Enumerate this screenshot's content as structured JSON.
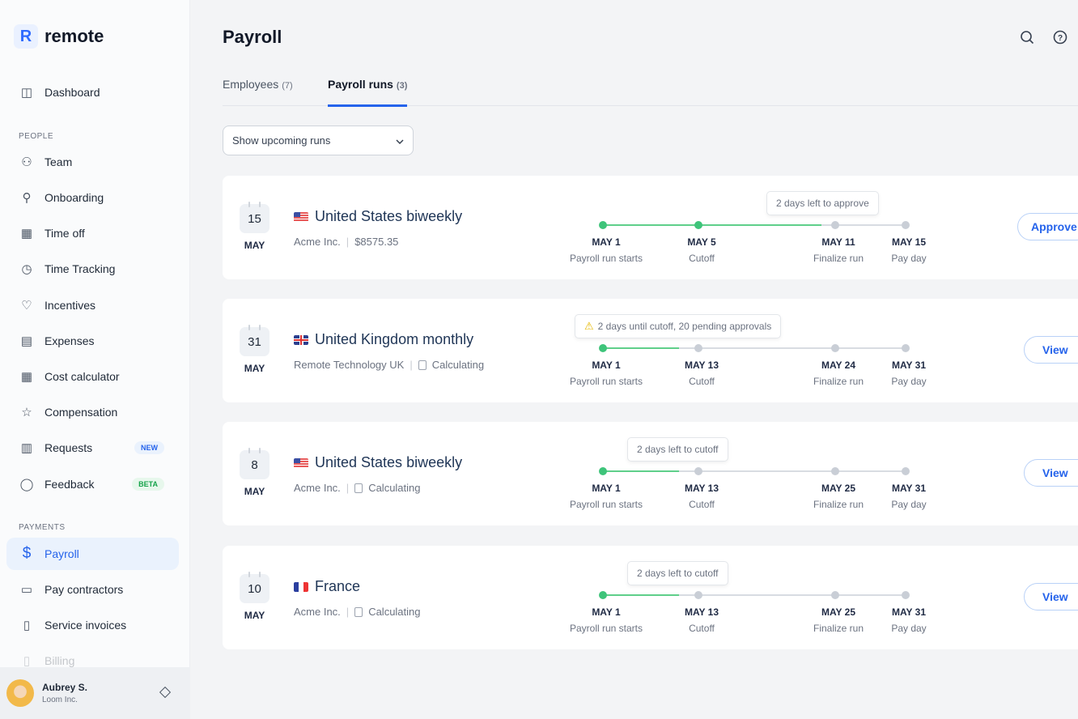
{
  "app": {
    "logo_text": "remote",
    "logo_mark": "R"
  },
  "sidebar": {
    "items": [
      {
        "label": "Dashboard",
        "icon": "sidebar-panel-icon",
        "glyph": "◫"
      },
      {
        "label": "Team",
        "icon": "team-icon",
        "glyph": "⚇"
      },
      {
        "label": "Onboarding",
        "icon": "user-plus-icon",
        "glyph": "⚲"
      },
      {
        "label": "Time off",
        "icon": "calendar-icon",
        "glyph": "▦"
      },
      {
        "label": "Time Tracking",
        "icon": "clock-icon",
        "glyph": "◷"
      },
      {
        "label": "Incentives",
        "icon": "heart-icon",
        "glyph": "♡"
      },
      {
        "label": "Expenses",
        "icon": "receipt-icon",
        "glyph": "▤"
      },
      {
        "label": "Cost calculator",
        "icon": "calculator-icon",
        "glyph": "▦"
      },
      {
        "label": "Compensation",
        "icon": "star-icon",
        "glyph": "☆"
      },
      {
        "label": "Requests",
        "icon": "request-icon",
        "glyph": "▥",
        "badge": "NEW"
      },
      {
        "label": "Feedback",
        "icon": "chat-bubble-icon",
        "glyph": "◯",
        "badge": "BETA"
      },
      {
        "label": "Payroll",
        "icon": "dollar-icon",
        "glyph": "$"
      },
      {
        "label": "Pay contractors",
        "icon": "card-icon",
        "glyph": "▭"
      },
      {
        "label": "Service invoices",
        "icon": "invoice-icon",
        "glyph": "▯"
      },
      {
        "label": "Billing",
        "icon": "billing-icon",
        "glyph": "▯"
      }
    ],
    "sections": {
      "people": "PEOPLE",
      "payments": "PAYMENTS"
    },
    "user": {
      "name": "Aubrey S.",
      "company": "Loom Inc."
    }
  },
  "header": {
    "title": "Payroll"
  },
  "tabs": [
    {
      "label": "Employees",
      "count": "(7)"
    },
    {
      "label": "Payroll runs",
      "count": "(3)"
    }
  ],
  "filter": {
    "value": "Show upcoming runs"
  },
  "colors": {
    "accent": "#2563eb",
    "progress": "#3ec47a"
  },
  "runs": [
    {
      "day": "15",
      "month": "MAY",
      "flag": "us",
      "name": "United States biweekly",
      "entity": "Acme Inc.",
      "detail": "$8575.35",
      "tooltip": "2 days left to approve",
      "warning": false,
      "completed_steps": 2,
      "progress_to_next": 0.9,
      "action": "Approve",
      "milestones": [
        {
          "date": "MAY 1",
          "label": "Payroll run starts"
        },
        {
          "date": "MAY 5",
          "label": "Cutoff"
        },
        {
          "date": "MAY 11",
          "label": "Finalize run"
        },
        {
          "date": "MAY 15",
          "label": "Pay day"
        }
      ]
    },
    {
      "day": "31",
      "month": "MAY",
      "flag": "uk",
      "name": "United Kingdom monthly",
      "entity": "Remote Technology UK",
      "detail": "Calculating",
      "tooltip": "2 days until cutoff, 20 pending approvals",
      "warning": true,
      "completed_steps": 1,
      "progress_to_next": 0.8,
      "action": "View",
      "milestones": [
        {
          "date": "MAY 1",
          "label": "Payroll run starts"
        },
        {
          "date": "MAY 13",
          "label": "Cutoff"
        },
        {
          "date": "MAY 24",
          "label": "Finalize run"
        },
        {
          "date": "MAY 31",
          "label": "Pay day"
        }
      ]
    },
    {
      "day": "8",
      "month": "MAY",
      "flag": "us",
      "name": "United States biweekly",
      "entity": "Acme Inc.",
      "detail": "Calculating",
      "tooltip": "2 days left to cutoff",
      "warning": false,
      "completed_steps": 1,
      "progress_to_next": 0.8,
      "action": "View",
      "milestones": [
        {
          "date": "MAY 1",
          "label": "Payroll run starts"
        },
        {
          "date": "MAY 13",
          "label": "Cutoff"
        },
        {
          "date": "MAY 25",
          "label": "Finalize run"
        },
        {
          "date": "MAY 31",
          "label": "Pay day"
        }
      ]
    },
    {
      "day": "10",
      "month": "MAY",
      "flag": "fr",
      "name": "France",
      "entity": "Acme Inc.",
      "detail": "Calculating",
      "tooltip": "2 days left to cutoff",
      "warning": false,
      "completed_steps": 1,
      "progress_to_next": 0.8,
      "action": "View",
      "milestones": [
        {
          "date": "MAY 1",
          "label": "Payroll run starts"
        },
        {
          "date": "MAY 13",
          "label": "Cutoff"
        },
        {
          "date": "MAY 25",
          "label": "Finalize run"
        },
        {
          "date": "MAY 31",
          "label": "Pay day"
        }
      ]
    }
  ]
}
